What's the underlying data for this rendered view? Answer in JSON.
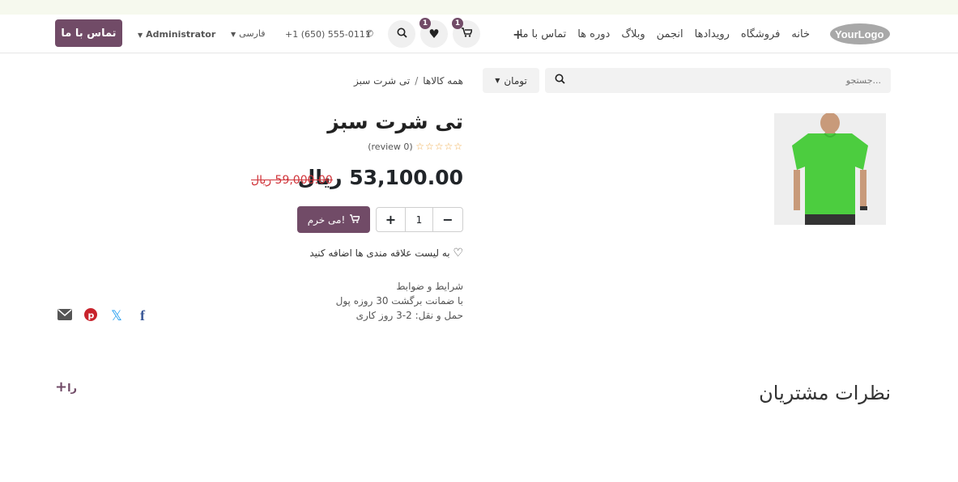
{
  "header": {
    "logo": "YourLogo",
    "menu": [
      "خانه",
      "فروشگاه",
      "رویدادها",
      "انجمن",
      "وبلاگ",
      "دوره ها",
      "تماس با ما"
    ],
    "cart_count": "1",
    "wishlist_count": "1",
    "phone": "+1 (650) 555-0111",
    "language": "فارسی",
    "user": "Administrator",
    "contact_button": "تماس با ما"
  },
  "search": {
    "placeholder": "جستجو...",
    "currency": "تومان"
  },
  "breadcrumb": {
    "parent": "همه کالاها",
    "separator": "/",
    "current": "تی شرت سبز"
  },
  "product": {
    "title": "تی شرت سبز",
    "stars": "☆☆☆☆☆",
    "review_count": "(0 review)",
    "price": "53,100.00 ریال",
    "old_price": "59,000.00 ریال",
    "quantity": "1",
    "add_to_cart": "می خرم!",
    "wishlist_label": "به لیست علاقه مندی ها اضافه کنید",
    "terms": [
      "شرایط و ضوابط",
      "با ضمانت برگشت 30 روزه پول",
      "حمل و نقل: 2-3 روز کاری"
    ],
    "image_color": "#4ccd3f"
  },
  "share": {
    "icons": [
      "facebook-icon",
      "x-icon",
      "pinterest-icon",
      "email-icon"
    ]
  },
  "reviews": {
    "title": "نظرات مشتریان",
    "add_label": "را"
  },
  "colors": {
    "brand": "#714b67",
    "old_price": "#d0343a",
    "star": "#f0ad4e"
  }
}
